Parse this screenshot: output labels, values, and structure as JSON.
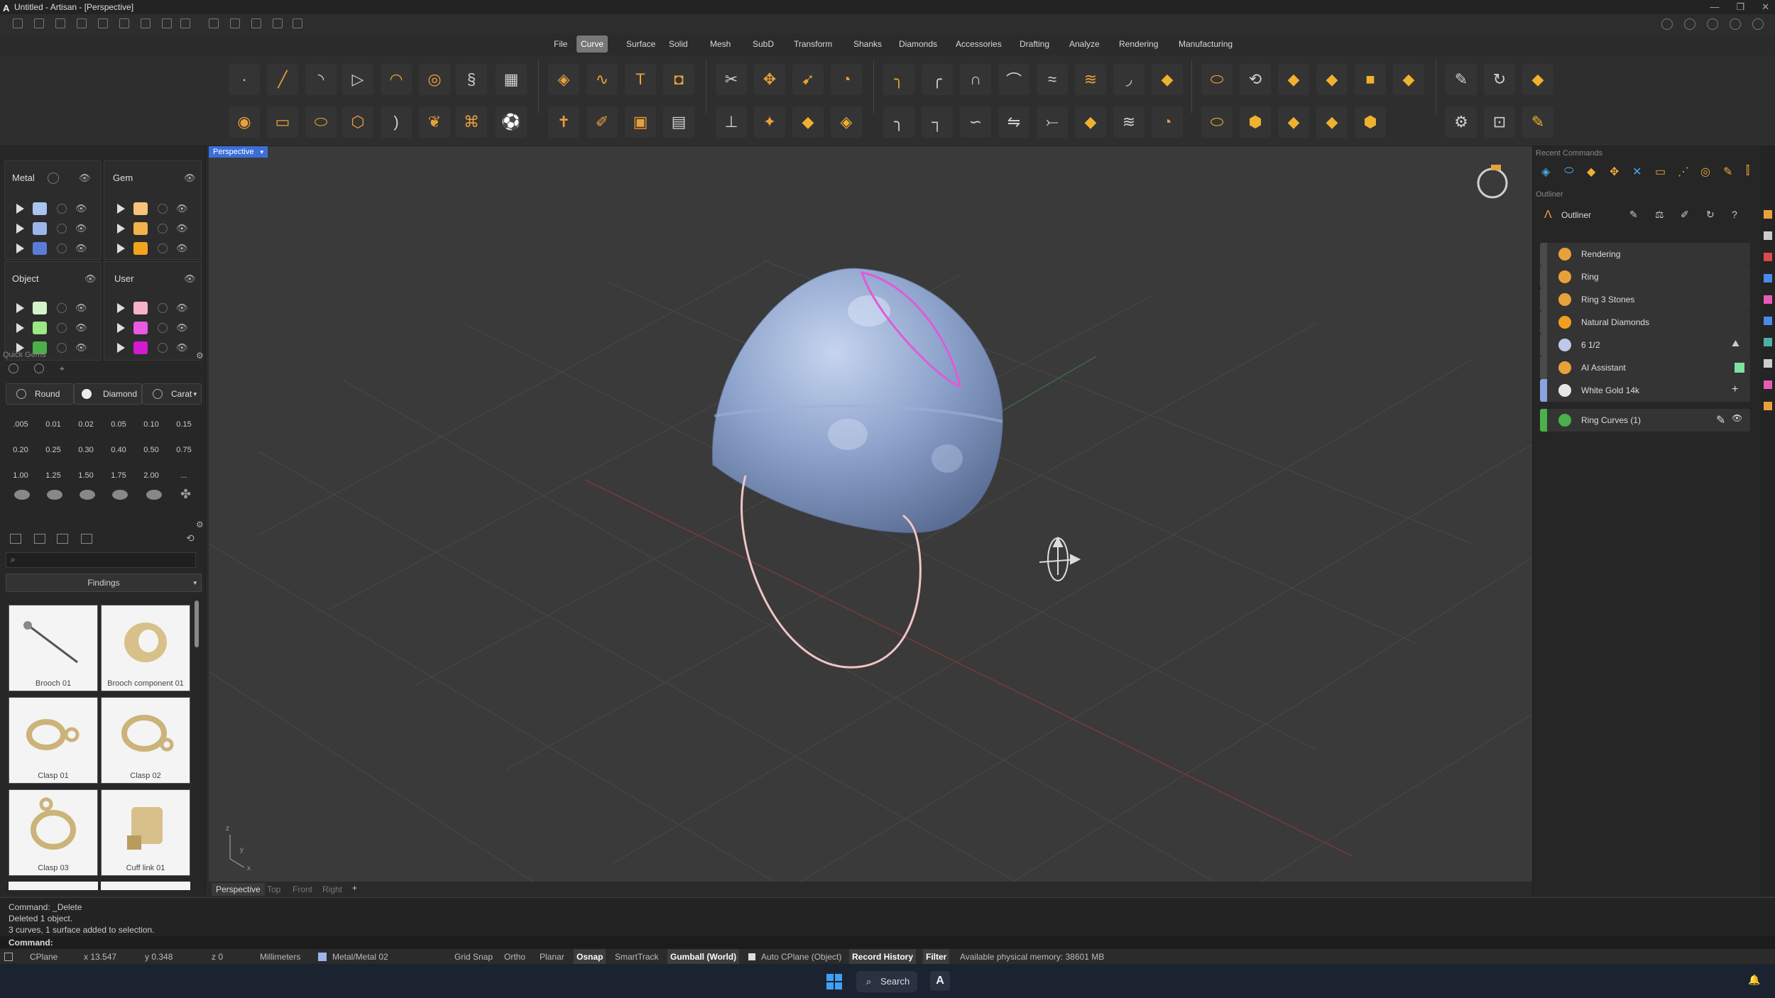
{
  "window": {
    "title": "Untitled - Artisan - [Perspective]",
    "buttons": [
      "—",
      "❐",
      "✕"
    ]
  },
  "menu": {
    "items": [
      "File",
      "Curve",
      "Surface",
      "Solid",
      "Mesh",
      "SubD",
      "Transform",
      "Shanks",
      "Diamonds",
      "Accessories",
      "Drafting",
      "Analyze",
      "Rendering",
      "Manufacturing"
    ],
    "active": "Curve"
  },
  "layers": {
    "metal": {
      "title": "Metal",
      "colors": [
        "#a9c4ee",
        "#9bb6ea",
        "#5b7bd8"
      ]
    },
    "gem": {
      "title": "Gem",
      "colors": [
        "#f7c27a",
        "#f3b24a",
        "#f2a41e"
      ]
    },
    "object": {
      "title": "Object",
      "colors": [
        "#d4f4c8",
        "#9ae886",
        "#4cb04a"
      ]
    },
    "user": {
      "title": "User",
      "colors": [
        "#f7b2c8",
        "#e85ae2",
        "#d41ad0"
      ]
    }
  },
  "quick_gems": {
    "title": "Quick Gems",
    "shape": "Round",
    "material": "Diamond",
    "unit": "Carat",
    "carats": [
      ".005",
      "0.01",
      "0.02",
      "0.05",
      "0.10",
      "0.15",
      "0.20",
      "0.25",
      "0.30",
      "0.40",
      "0.50",
      "0.75",
      "1.00",
      "1.25",
      "1.50",
      "1.75",
      "2.00",
      "..."
    ]
  },
  "library": {
    "search_placeholder": "",
    "category": "Findings",
    "items": [
      "Brooch 01",
      "Brooch component 01",
      "Clasp 01",
      "Clasp 02",
      "Clasp 03",
      "Cuff link 01"
    ]
  },
  "viewport": {
    "label": "Perspective",
    "tabs": [
      "Perspective",
      "Top",
      "Front",
      "Right",
      "+"
    ],
    "axis_x": "x",
    "axis_y": "y",
    "axis_z": "z"
  },
  "recent_commands": {
    "title": "Recent Commands"
  },
  "outliner": {
    "panel_title": "Outliner",
    "header": "Outliner",
    "rows": [
      {
        "label": "Rendering",
        "icon": "palette-icon",
        "color": "#e8a13a"
      },
      {
        "label": "Ring",
        "icon": "ring-icon",
        "color": "#e8a13a"
      },
      {
        "label": "Ring 3 Stones",
        "icon": "ring-stones-icon",
        "color": "#e8a13a"
      },
      {
        "label": "Natural Diamonds",
        "icon": "diamond-icon",
        "color": "#f0a020"
      },
      {
        "label": "6 1/2",
        "icon": "us-flag-icon",
        "color": "#c0c8e8"
      },
      {
        "label": "AI Assistant",
        "icon": "ai-assistant-icon",
        "color": "#e8a13a"
      },
      {
        "label": "White Gold 14k",
        "icon": "metal-sphere-icon",
        "color": "#e6e6e6"
      },
      {
        "label": "Ring Curves (1)",
        "icon": "curve-icon",
        "color": "#4cb04a"
      }
    ]
  },
  "command_history": [
    "Command: _Delete",
    "Deleted 1 object.",
    "3 curves, 1 surface added to selection."
  ],
  "command_prompt": "Command:",
  "status": {
    "cplane": "CPlane",
    "x": "x 13.547",
    "y": "y 0.348",
    "z": "z 0",
    "units": "Millimeters",
    "layer": "Metal/Metal 02",
    "grid_snap": "Grid Snap",
    "ortho": "Ortho",
    "planar": "Planar",
    "osnap": "Osnap",
    "smarttrack": "SmartTrack",
    "gumball": "Gumball (World)",
    "auto_cplane": "Auto CPlane (Object)",
    "record_history": "Record History",
    "filter": "Filter",
    "memory": "Available physical memory: 38601 MB"
  },
  "taskbar": {
    "search": "Search"
  }
}
